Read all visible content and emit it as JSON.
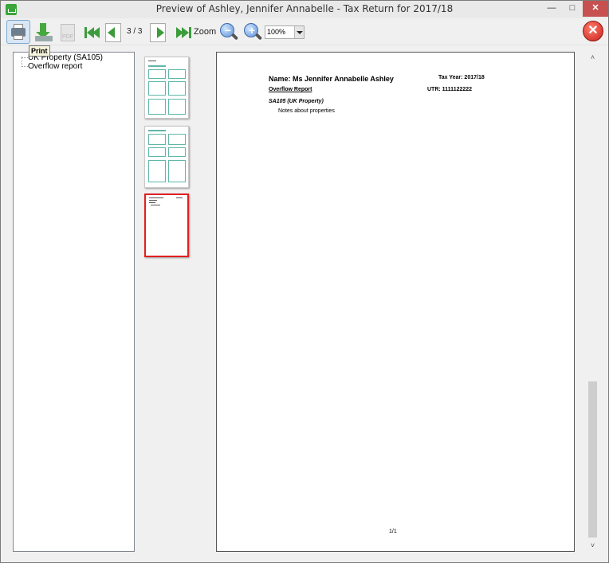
{
  "window": {
    "title": "Preview of Ashley, Jennifer Annabelle - Tax Return for 2017/18",
    "minimize_glyph": "—",
    "maximize_glyph": "□",
    "close_glyph": "✕"
  },
  "toolbar": {
    "print_tooltip": "Print",
    "pdf_label": "PDF",
    "page_counter": "3 / 3",
    "zoom_label": "Zoom",
    "zoom_in_glyph": "+",
    "zoom_out_glyph": "−",
    "zoom_value": "100%",
    "close_glyph": "✕"
  },
  "tree": {
    "items": [
      "UK Property (SA105)",
      "Overflow report"
    ]
  },
  "thumbnails": {
    "count": 3,
    "selected_index": 2
  },
  "document": {
    "name_line": "Name: Ms Jennifer Annabelle Ashley",
    "tax_year": "Tax Year: 2017/18",
    "report_title": "Overflow Report",
    "utr": "UTR: 1111122222",
    "section": "SA105 (UK Property)",
    "notes": "Notes about properties",
    "page_number": "1/1"
  },
  "scrollbar": {
    "up_glyph": "˄",
    "down_glyph": "˅"
  },
  "colors": {
    "selection_border": "#e02020",
    "thumbnail_accent": "#5fb7a9",
    "close_button": "#c75050"
  }
}
